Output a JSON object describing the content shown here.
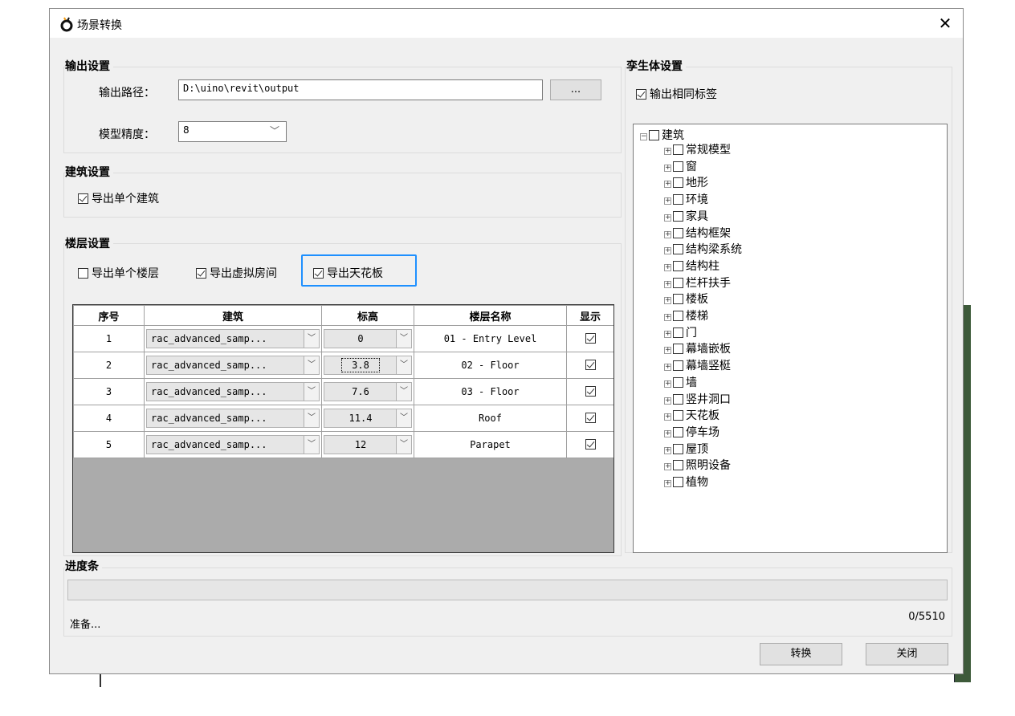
{
  "window": {
    "title": "场景转换",
    "close_symbol": "✕"
  },
  "output": {
    "group_title": "输出设置",
    "path_label": "输出路径：",
    "path_value": "D:\\uino\\revit\\output",
    "browse_label": "...",
    "precision_label": "模型精度：",
    "precision_value": "8"
  },
  "building": {
    "group_title": "建筑设置",
    "export_single_label": "导出单个建筑"
  },
  "floor": {
    "group_title": "楼层设置",
    "single_floor_label": "导出单个楼层",
    "virtual_room_label": "导出虚拟房间",
    "ceiling_label": "导出天花板",
    "table": {
      "headers": [
        "序号",
        "建筑",
        "标高",
        "楼层名称",
        "显示"
      ],
      "rows": [
        {
          "index": "1",
          "building": "rac_advanced_samp...",
          "level": "0",
          "name": "01 - Entry Level",
          "show": true
        },
        {
          "index": "2",
          "building": "rac_advanced_samp...",
          "level": "3.8",
          "name": "02 - Floor",
          "show": true
        },
        {
          "index": "3",
          "building": "rac_advanced_samp...",
          "level": "7.6",
          "name": "03 - Floor",
          "show": true
        },
        {
          "index": "4",
          "building": "rac_advanced_samp...",
          "level": "11.4",
          "name": "Roof",
          "show": true
        },
        {
          "index": "5",
          "building": "rac_advanced_samp...",
          "level": "12",
          "name": "Parapet",
          "show": true
        }
      ]
    }
  },
  "twins": {
    "group_title": "孪生体设置",
    "same_label_label": "输出相同标签",
    "tree_root": "建筑",
    "tree_items": [
      "常规模型",
      "窗",
      "地形",
      "环境",
      "家具",
      "结构框架",
      "结构梁系统",
      "结构柱",
      "栏杆扶手",
      "楼板",
      "楼梯",
      "门",
      "幕墙嵌板",
      "幕墙竖梃",
      "墙",
      "竖井洞口",
      "天花板",
      "停车场",
      "屋顶",
      "照明设备",
      "植物"
    ]
  },
  "progress": {
    "group_title": "进度条",
    "status": "准备...",
    "count": "0/5510",
    "fraction": 0
  },
  "buttons": {
    "convert": "转换",
    "close": "关闭"
  },
  "icons": {
    "app": "app-logo-icon",
    "dropdown": "chevron-down-icon",
    "expander": "plus-expander-icon",
    "collapser": "minus-expander-icon"
  }
}
